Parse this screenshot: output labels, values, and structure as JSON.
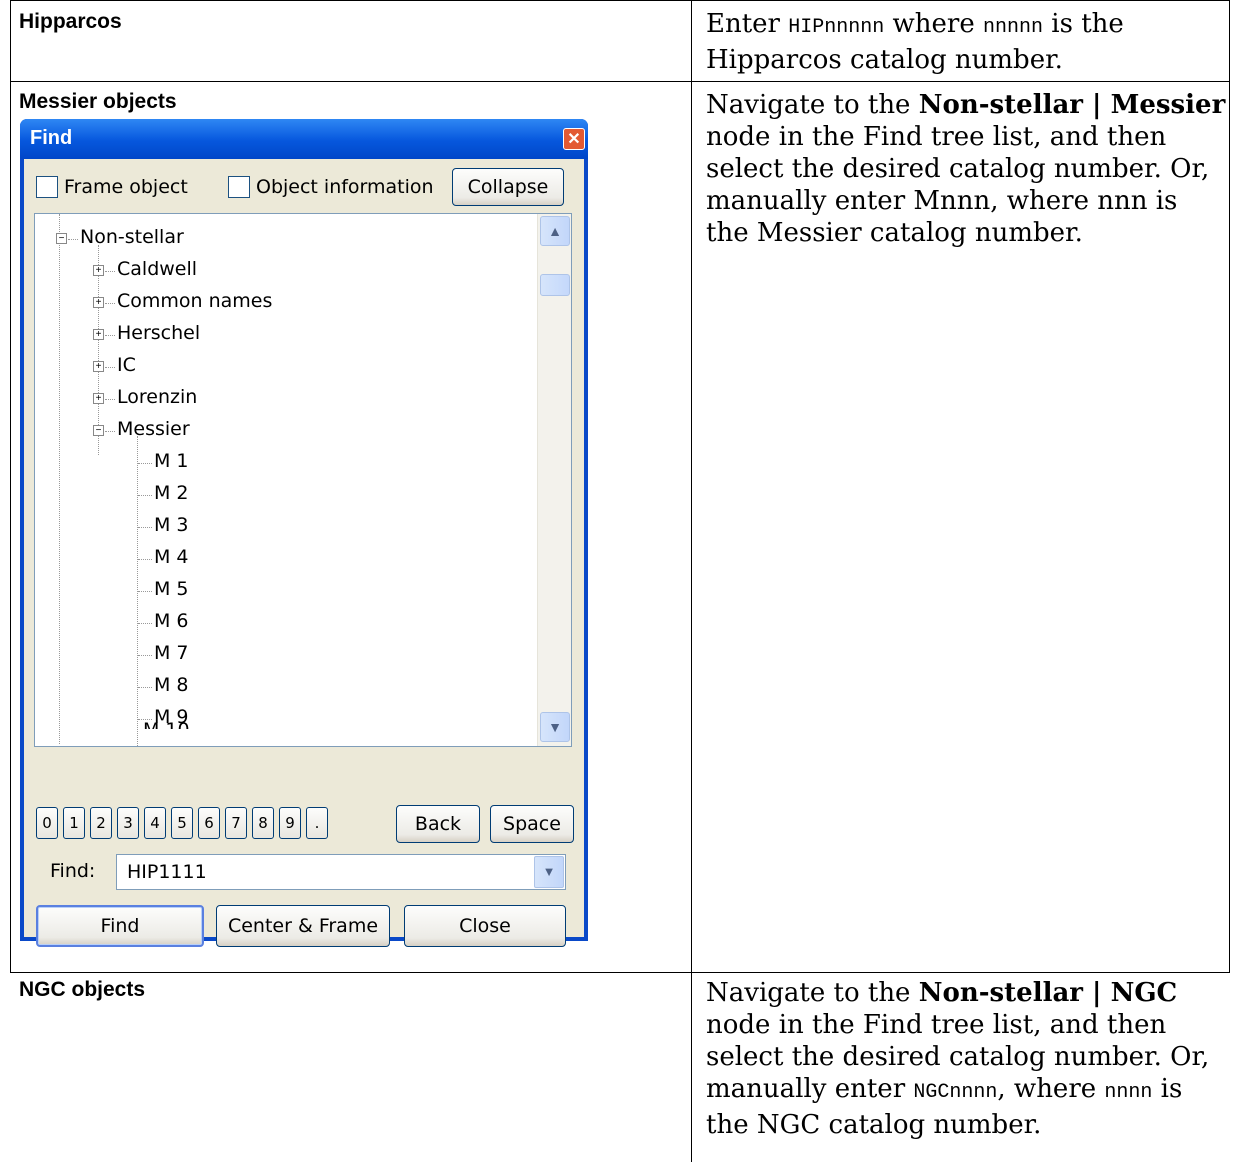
{
  "rows": {
    "hipparcos": {
      "label": "Hipparcos",
      "desc_1": "Enter ",
      "desc_code": "HIPnnnnn",
      "desc_2": " where ",
      "desc_code2": "nnnnn",
      "desc_3": " is the Hipparcos catalog number."
    },
    "messier": {
      "label": "Messier objects",
      "desc_1": "Navigate to the ",
      "desc_bold": "Non-stellar | Messier",
      "desc_2": " node in the Find tree list, and then select the desired catalog number. Or, manually enter Mnnn, where nnn is the Messier catalog number."
    },
    "ngc": {
      "label": "NGC objects",
      "desc_1": "Navigate to the ",
      "desc_bold": "Non-stellar | NGC",
      "desc_2": " node in the Find tree list, and then select the desired catalog number. Or, manually enter ",
      "desc_code": "NGCnnnn",
      "desc_3": ", where ",
      "desc_code2": "nnnn",
      "desc_4": " is the NGC catalog number."
    }
  },
  "dialog": {
    "title": "Find",
    "close_glyph": "✕",
    "frame_object": "Frame object",
    "object_information": "Object information",
    "collapse": "Collapse",
    "tree_root": "Non-stellar",
    "tree_groups": [
      "Caldwell",
      "Common names",
      "Herschel",
      "IC",
      "Lorenzin",
      "Messier"
    ],
    "messier_items": [
      "M 1",
      "M 2",
      "M 3",
      "M 4",
      "M 5",
      "M 6",
      "M 7",
      "M 8",
      "M 9"
    ],
    "keypad": [
      "0",
      "1",
      "2",
      "3",
      "4",
      "5",
      "6",
      "7",
      "8",
      "9",
      "."
    ],
    "back": "Back",
    "space": "Space",
    "find_label": "Find:",
    "find_value": "HIP1111",
    "find_button": "Find",
    "center_frame": "Center & Frame",
    "close_button": "Close"
  }
}
